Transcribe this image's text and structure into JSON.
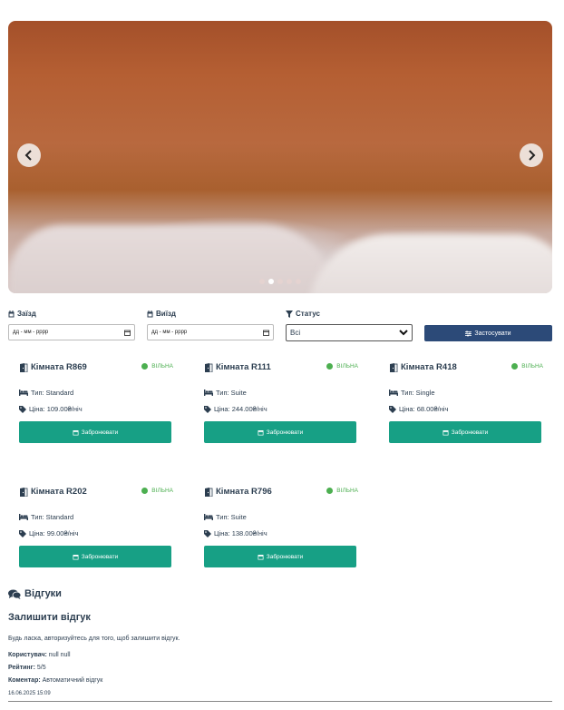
{
  "carousel": {
    "dots": 5,
    "active_dot": 1
  },
  "filters": {
    "checkin_label": "Заїзд",
    "checkout_label": "Виїзд",
    "status_label": "Статус",
    "checkin_placeholder": "дд - мм - рррр",
    "checkout_placeholder": "дд - мм - рррр",
    "status_value": "Всі",
    "apply_label": "Застосувати"
  },
  "rooms": [
    {
      "title": "Кімната R869",
      "status": "ВІЛЬНА",
      "type": "Тип: Standard",
      "price": "Ціна: 109.00₴/ніч",
      "book": "Забронювати"
    },
    {
      "title": "Кімната R111",
      "status": "ВІЛЬНА",
      "type": "Тип: Suite",
      "price": "Ціна: 244.00₴/ніч",
      "book": "Забронювати"
    },
    {
      "title": "Кімната R418",
      "status": "ВІЛЬНА",
      "type": "Тип: Single",
      "price": "Ціна: 68.00₴/ніч",
      "book": "Забронювати"
    },
    {
      "title": "Кімната R202",
      "status": "ВІЛЬНА",
      "type": "Тип: Standard",
      "price": "Ціна: 99.00₴/ніч",
      "book": "Забронювати"
    },
    {
      "title": "Кімната R796",
      "status": "ВІЛЬНА",
      "type": "Тип: Suite",
      "price": "Ціна: 138.00₴/ніч",
      "book": "Забронювати"
    }
  ],
  "reviews": {
    "heading": "Відгуки",
    "leave_heading": "Залишити відгук",
    "login_note": "Будь ласка, авторизуйтесь для того, щоб залишити відгук.",
    "items": [
      {
        "user_label": "Користувач:",
        "user": "null null",
        "rating_label": "Рейтинг:",
        "rating": "5/5",
        "comment_label": "Коментар:",
        "comment": "Автоматичний відгук",
        "date": "16.06.2025 15:09"
      }
    ]
  },
  "colors": {
    "primary": "#2c4a78",
    "book": "#17a085",
    "available": "#4caf50",
    "text": "#2c3e50"
  }
}
